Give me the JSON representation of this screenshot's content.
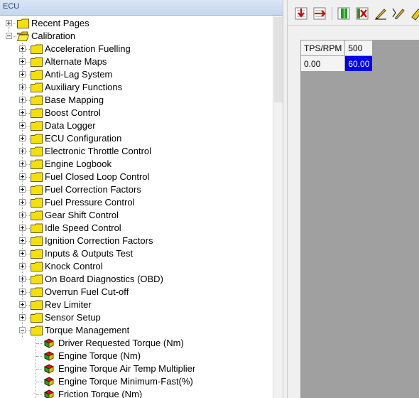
{
  "panel": {
    "title": "ECU"
  },
  "tree": {
    "top_nodes": [
      {
        "label": "Recent Pages",
        "expanded": false
      },
      {
        "label": "Calibration",
        "expanded": true
      }
    ],
    "calibration_children": [
      "Acceleration Fuelling",
      "Alternate Maps",
      "Anti-Lag System",
      "Auxiliary Functions",
      "Base Mapping",
      "Boost Control",
      "Data Logger",
      "ECU Configuration",
      "Electronic Throttle Control",
      "Engine Logbook",
      "Fuel Closed Loop Control",
      "Fuel Correction Factors",
      "Fuel Pressure Control",
      "Gear Shift Control",
      "Idle Speed Control",
      "Ignition Correction Factors",
      "Inputs & Outputs Test",
      "Knock Control",
      "On Board Diagnostics (OBD)",
      "Overrun Fuel Cut-off",
      "Rev Limiter",
      "Sensor Setup",
      "Torque Management"
    ],
    "torque_children": [
      "Driver Requested Torque (Nm)",
      "Engine Torque (Nm)",
      "Engine Torque Air Temp Multiplier",
      "Engine Torque Minimum-Fast(%)",
      "Friction Torque (Nm)"
    ]
  },
  "map_table": {
    "corner_label": "TPS/RPM",
    "col_header": "500",
    "row_header": "0.00",
    "cell_value": "60.00"
  },
  "toolbar": {
    "buttons": [
      "import-icon",
      "export-icon",
      "copy-icon",
      "paste-icon",
      "edit-icon",
      "interpolate-icon",
      "eraser-icon"
    ]
  },
  "colors": {
    "folder": "#f6e000",
    "selected_cell": "#0000ee",
    "grid_background": "#a0a0a0"
  }
}
